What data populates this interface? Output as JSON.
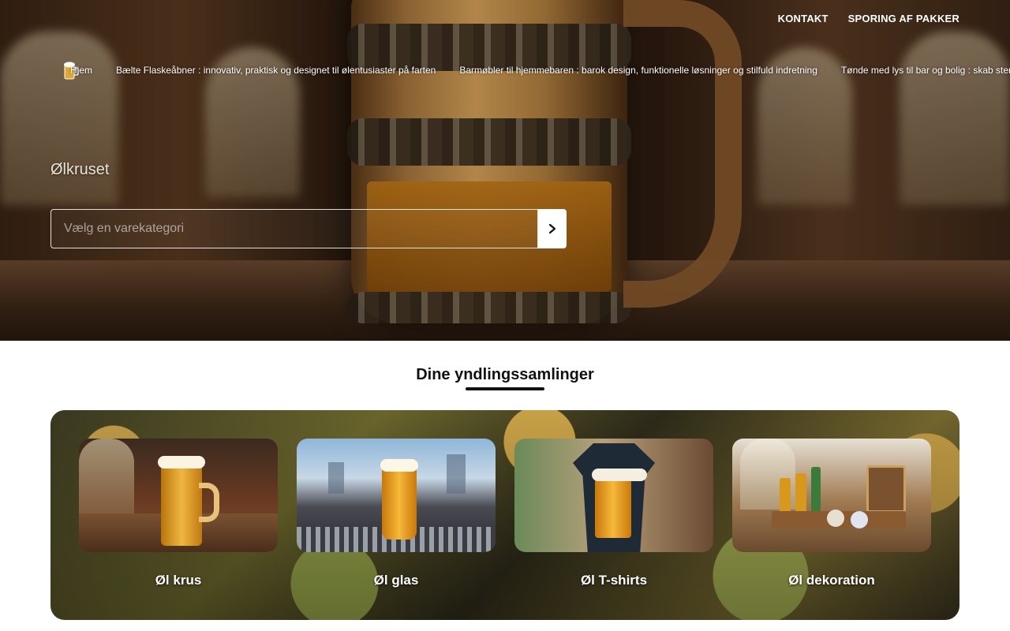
{
  "top_nav": {
    "contact": "KONTAKT",
    "tracking": "SPORING AF PAKKER"
  },
  "menu": {
    "items": [
      "Hjem",
      "Bælte Flaskeåbner : innovativ, praktisk og designet til ølentusiaster på farten",
      "Barmøbler til hjemmebaren : barok design, funktionelle løsninger og stilfuld indretning",
      "Tønde med lys til bar og bolig : skab stem"
    ]
  },
  "hero": {
    "site_name": "Ølkruset",
    "search_placeholder": "Vælg en varekategori"
  },
  "section": {
    "title": "Dine yndlingssamlinger"
  },
  "collections": [
    {
      "label": "Øl krus",
      "icon": "beer-mug-image"
    },
    {
      "label": "Øl glas",
      "icon": "beer-glass-image"
    },
    {
      "label": "Øl T-shirts",
      "icon": "beer-tshirt-image"
    },
    {
      "label": "Øl dekoration",
      "icon": "beer-decoration-image"
    }
  ],
  "colors": {
    "text_dark": "#111111",
    "white": "#ffffff",
    "beer_amber": "#c57a16"
  }
}
